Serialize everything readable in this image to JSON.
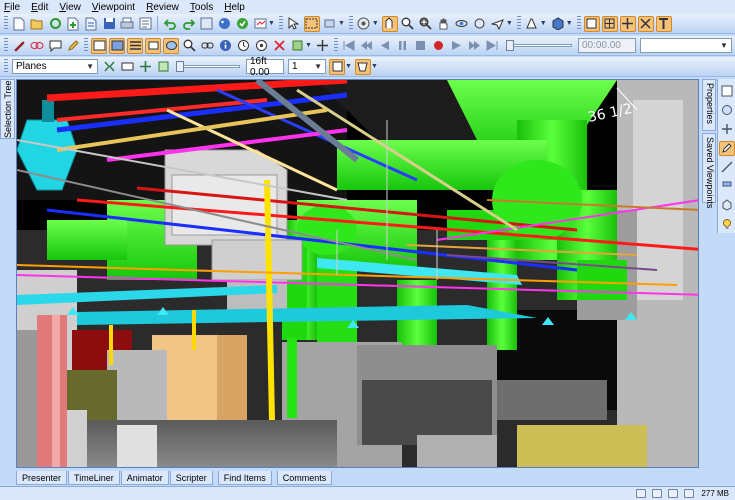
{
  "menu": {
    "items": [
      "File",
      "Edit",
      "View",
      "Viewpoint",
      "Review",
      "Tools",
      "Help"
    ]
  },
  "toolbar": {
    "row1": [
      "new-icon",
      "open-icon",
      "refresh-icon",
      "append-icon",
      "merge-icon",
      "save-icon",
      "print-icon",
      "publish-icon",
      "undo-icon",
      "redo-icon",
      "sheet-icon",
      "palette-icon",
      "clash-icon",
      "timeliner-icon",
      "select-icon",
      "select-box-icon",
      "hide-icon",
      "navigation-wheel-icon",
      "look-around-icon",
      "zoom-icon",
      "zoom-box-icon",
      "pan-icon",
      "orbit-icon",
      "examine-icon",
      "fly-icon",
      "perspective-icon",
      "shading-icon",
      "lighting-icon",
      "render-style-icon",
      "grid-icon",
      "section-icon",
      "text-icon"
    ],
    "row2": [
      "redline-icon",
      "cloud-icon",
      "tag-icon",
      "pencil-icon",
      "comments-icon",
      "viewpoint-a-icon",
      "viewpoint-b-icon",
      "viewpoint-c-icon",
      "viewpoint-d-icon",
      "viewpoint-e-icon",
      "find-icon",
      "link-icon",
      "info-icon",
      "sync-icon",
      "measure-icon",
      "clear-icon",
      "transform-icon",
      "move-icon",
      "rewind-icon",
      "step-back-icon",
      "reverse-icon",
      "pause-icon",
      "stop-icon",
      "record-icon",
      "play-icon",
      "step-icon",
      "forward-icon",
      "end-icon"
    ],
    "time_value": "00:00.00",
    "animation_select": ""
  },
  "sectioning": {
    "mode_value": "Planes",
    "distance_value": "16ft 0.00",
    "plane_value": "1"
  },
  "side_tabs": {
    "left": "Selection Tree",
    "right_top": "Properties",
    "right_bottom": "Saved Viewpoints"
  },
  "right_strip_icons": [
    "properties-icon",
    "viewpoints-icon",
    "navigate-icon",
    "edit-icon",
    "measure-icon",
    "paint-icon",
    "material-icon",
    "plugin-icon"
  ],
  "bottom_tabs": [
    "Presenter",
    "TimeLiner",
    "Animator",
    "Scripter",
    "Find Items",
    "Comments"
  ],
  "status": {
    "memory": "277 MB"
  },
  "viewport": {
    "handwriting": "36 1/2"
  },
  "colors": {
    "duct": "#22ee11",
    "pipe_red": "#ff1a1a",
    "pipe_blue": "#1a2eff",
    "pipe_yellow": "#ffd800",
    "pipe_magenta": "#ff33ee",
    "light_cyan": "#22d8e6",
    "accent_toolbar": "#f6c27a"
  }
}
